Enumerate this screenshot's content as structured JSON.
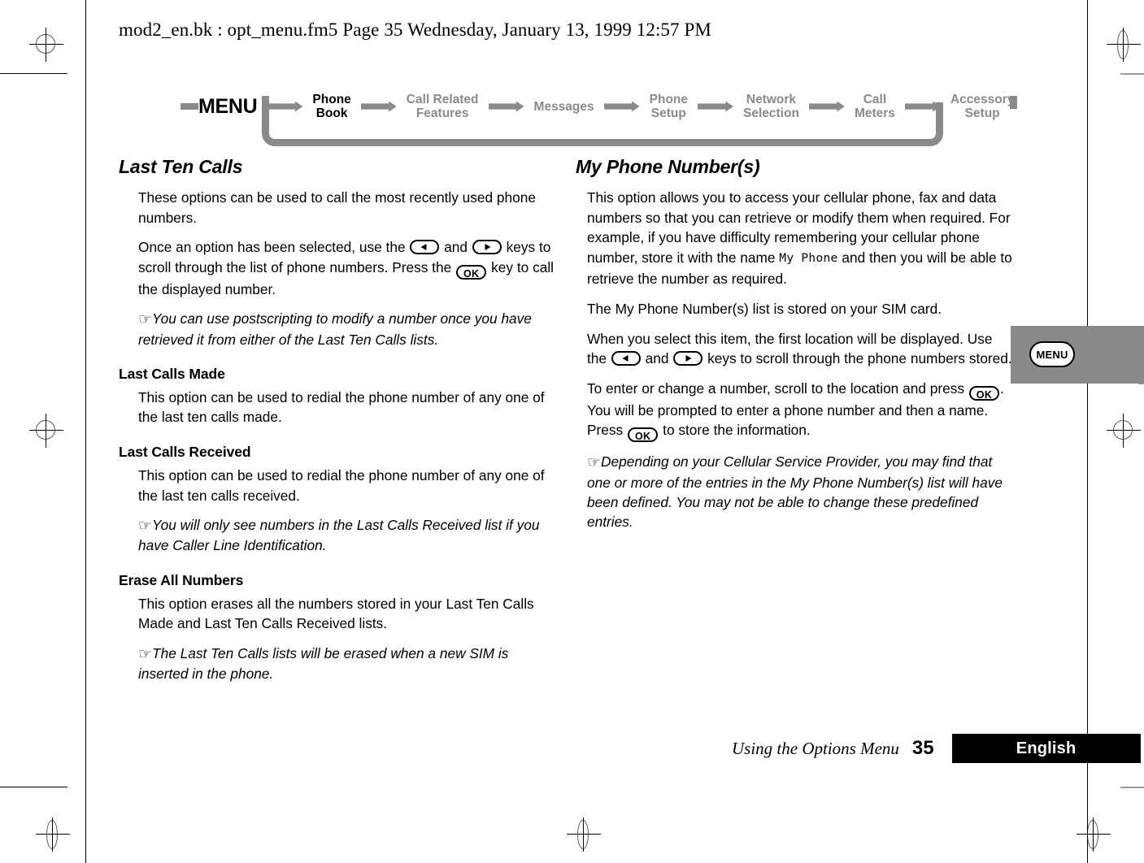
{
  "file_header": "mod2_en.bk : opt_menu.fm5  Page 35  Wednesday, January 13, 1999  12:57 PM",
  "nav": {
    "menu_label": "MENU",
    "items": [
      {
        "label": "Phone\nBook",
        "line1": "Phone",
        "line2": "Book",
        "active": true
      },
      {
        "label": "Call Related Features",
        "line1": "Call Related",
        "line2": "Features",
        "active": false
      },
      {
        "label": "Messages",
        "line1": "Messages",
        "line2": "",
        "active": false
      },
      {
        "label": "Phone Setup",
        "line1": "Phone",
        "line2": "Setup",
        "active": false
      },
      {
        "label": "Network Selection",
        "line1": "Network",
        "line2": "Selection",
        "active": false
      },
      {
        "label": "Call Meters",
        "line1": "Call",
        "line2": "Meters",
        "active": false
      },
      {
        "label": "Accessory Setup",
        "line1": "Accessory",
        "line2": "Setup",
        "active": false
      }
    ]
  },
  "left_column": {
    "section_title": "Last Ten Calls",
    "p1": "These options can be used to call the most recently used phone numbers.",
    "p2_part1": "Once an option has been selected, use the ",
    "p2_part2": " and ",
    "p2_part3": " keys to scroll through the list of phone numbers. Press the ",
    "p2_part4": " key to call the displayed number.",
    "note1": "You can use postscripting to modify a number once you have retrieved it from either of the Last Ten Calls lists.",
    "sub1_title": "Last Calls Made",
    "sub1_body": "This option can be used to redial the phone number of any one of the last ten calls made.",
    "sub2_title": "Last Calls Received",
    "sub2_body": "This option can be used to redial the phone number of any one of the last ten calls received.",
    "note2": "You will only see numbers in the Last Calls Received list if you have Caller Line Identification.",
    "sub3_title": "Erase All Numbers",
    "sub3_body": "This option erases all the numbers stored in your Last Ten Calls Made and Last Ten Calls Received lists.",
    "note3": "The Last Ten Calls lists will be erased when a new SIM is inserted in the phone."
  },
  "right_column": {
    "section_title": "My Phone Number(s)",
    "p1_part1": "This option allows you to access your cellular phone, fax and data numbers so that you can retrieve or modify them when required. For example, if you have difficulty remembering your cellular phone number, store it with the name ",
    "p1_lcd": "My  Phone",
    "p1_part2": " and then you will be able to retrieve the number as required.",
    "p2": "The My Phone Number(s) list is stored on your SIM card.",
    "p3_part1": "When you select this item, the first location will be displayed. Use the ",
    "p3_part2": " and ",
    "p3_part3": " keys to scroll through the phone numbers stored.",
    "p4_part1": "To enter or change a number, scroll to the location and press ",
    "p4_part2": ". You will be prompted to enter a phone number and then a name. Press ",
    "p4_part3": " to store the information.",
    "note1": "Depending on your Cellular Service Provider, you may find that one or more of the entries in the My Phone Number(s) list will have been defined. You may not be able to change these predefined entries."
  },
  "side_tab": {
    "button_label": "MENU"
  },
  "footer": {
    "title": "Using the Options Menu",
    "page_number": "35",
    "language": "English"
  },
  "keys": {
    "ok_label": "OK",
    "left_arrow_name": "left-arrow-key",
    "right_arrow_name": "right-arrow-key"
  },
  "colors": {
    "nav_gray": "#8a8a8a",
    "side_tab_gray": "#8a8a8a",
    "footer_bar": "#000000",
    "text": "#000000"
  }
}
